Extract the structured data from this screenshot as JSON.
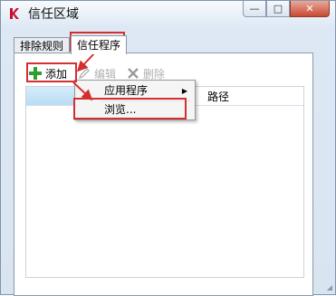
{
  "window": {
    "title": "信任区域",
    "controls": {
      "minimize": "—",
      "maximize": "□",
      "close": "✕"
    }
  },
  "tabs": [
    {
      "label": "排除规则",
      "active": false
    },
    {
      "label": "信任程序",
      "active": true
    }
  ],
  "toolbar": {
    "add_label": "添加",
    "edit_label": "编辑",
    "delete_label": "删除"
  },
  "list": {
    "columns": {
      "path": "路径"
    }
  },
  "context_menu": {
    "items": [
      {
        "label": "应用程序",
        "has_submenu": true
      },
      {
        "label": "浏览..."
      }
    ]
  },
  "colors": {
    "highlight": "#d42f2f",
    "add_icon": "#2e9e2e",
    "title_icon": "#c8102e"
  },
  "icons": {
    "app": "kaspersky-k-icon",
    "add": "plus-icon",
    "edit": "pencil-icon",
    "delete": "cross-icon",
    "submenu": "chevron-right-icon"
  }
}
